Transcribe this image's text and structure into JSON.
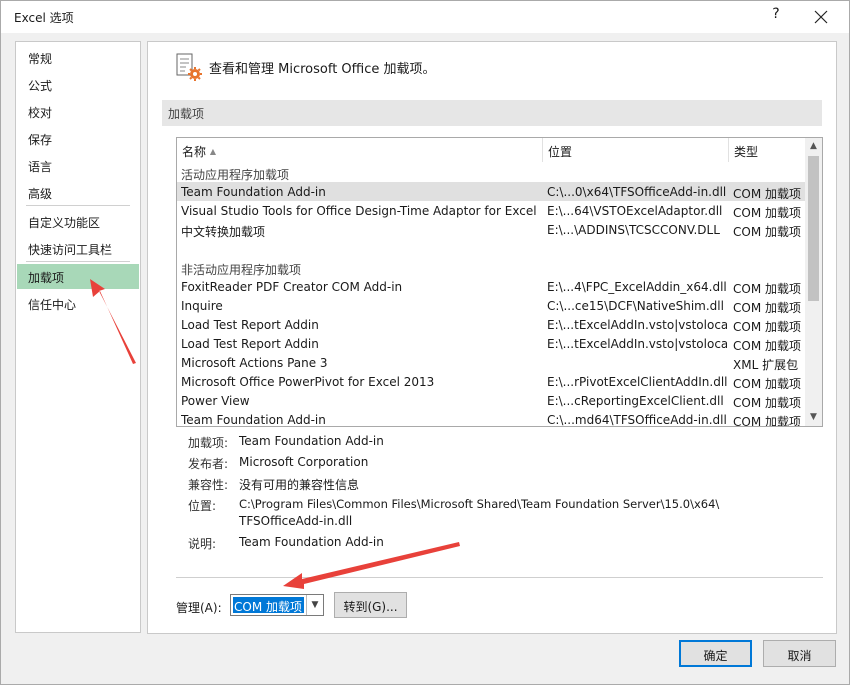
{
  "window": {
    "title": "Excel 选项",
    "help_label": "?",
    "close_label": "✕"
  },
  "sidebar": {
    "items": [
      {
        "label": "常规"
      },
      {
        "label": "公式"
      },
      {
        "label": "校对"
      },
      {
        "label": "保存"
      },
      {
        "label": "语言"
      },
      {
        "label": "高级"
      },
      {
        "label": "自定义功能区"
      },
      {
        "label": "快速访问工具栏"
      },
      {
        "label": "加载项",
        "selected": true
      },
      {
        "label": "信任中心"
      }
    ]
  },
  "header": {
    "icon": "addins-gear-icon",
    "text": "查看和管理 Microsoft Office 加载项。"
  },
  "section": {
    "title": "加载项"
  },
  "table": {
    "columns": {
      "name": "名称",
      "sort_glyph": "▲",
      "location": "位置",
      "type": "类型"
    },
    "group_active": "活动应用程序加载项",
    "active_rows": [
      {
        "name": "Team Foundation Add-in",
        "location": "C:\\...0\\x64\\TFSOfficeAdd-in.dll",
        "type": "COM 加载项",
        "selected": true
      },
      {
        "name": "Visual Studio Tools for Office Design-Time Adaptor for Excel",
        "location": "E:\\...64\\VSTOExcelAdaptor.dll",
        "type": "COM 加载项"
      },
      {
        "name": "中文转换加载项",
        "location": "E:\\...\\ADDINS\\TCSCCONV.DLL",
        "type": "COM 加载项"
      }
    ],
    "group_inactive": "非活动应用程序加载项",
    "inactive_rows": [
      {
        "name": "FoxitReader PDF Creator COM Add-in",
        "location": "E:\\...4\\FPC_ExcelAddin_x64.dll",
        "type": "COM 加载项"
      },
      {
        "name": "Inquire",
        "location": "C:\\...ce15\\DCF\\NativeShim.dll",
        "type": "COM 加载项"
      },
      {
        "name": "Load Test Report Addin",
        "location": "E:\\...tExcelAddIn.vsto|vstolocal",
        "type": "COM 加载项"
      },
      {
        "name": "Load Test Report Addin",
        "location": "E:\\...tExcelAddIn.vsto|vstolocal",
        "type": "COM 加载项"
      },
      {
        "name": "Microsoft Actions Pane 3",
        "location": "",
        "type": "XML 扩展包"
      },
      {
        "name": "Microsoft Office PowerPivot for Excel 2013",
        "location": "E:\\...rPivotExcelClientAddIn.dll",
        "type": "COM 加载项"
      },
      {
        "name": "Power View",
        "location": "E:\\...cReportingExcelClient.dll",
        "type": "COM 加载项"
      },
      {
        "name": "Team Foundation Add-in",
        "location": "C:\\...md64\\TFSOfficeAdd-in.dll",
        "type": "COM 加载项"
      }
    ],
    "scroll_up": "▲",
    "scroll_down": "▼"
  },
  "details": {
    "addin_label": "加载项:",
    "addin_value": "Team Foundation Add-in",
    "publisher_label": "发布者:",
    "publisher_value": "Microsoft Corporation",
    "compat_label": "兼容性:",
    "compat_value": "没有可用的兼容性信息",
    "location_label": "位置:",
    "location_value_line1": "C:\\Program Files\\Common Files\\Microsoft Shared\\Team Foundation Server\\15.0\\x64\\",
    "location_value_line2": "TFSOfficeAdd-in.dll",
    "desc_label": "说明:",
    "desc_value": "Team Foundation Add-in"
  },
  "manage": {
    "label": "管理(A):",
    "selected_value": "COM 加载项",
    "dropdown_glyph": "▼",
    "goto_label": "转到(G)..."
  },
  "buttons": {
    "ok": "确定",
    "cancel": "取消"
  },
  "colors": {
    "selected_nav": "#a8d8b8",
    "accent": "#0078d7",
    "annotation_arrow": "#e8413a"
  }
}
